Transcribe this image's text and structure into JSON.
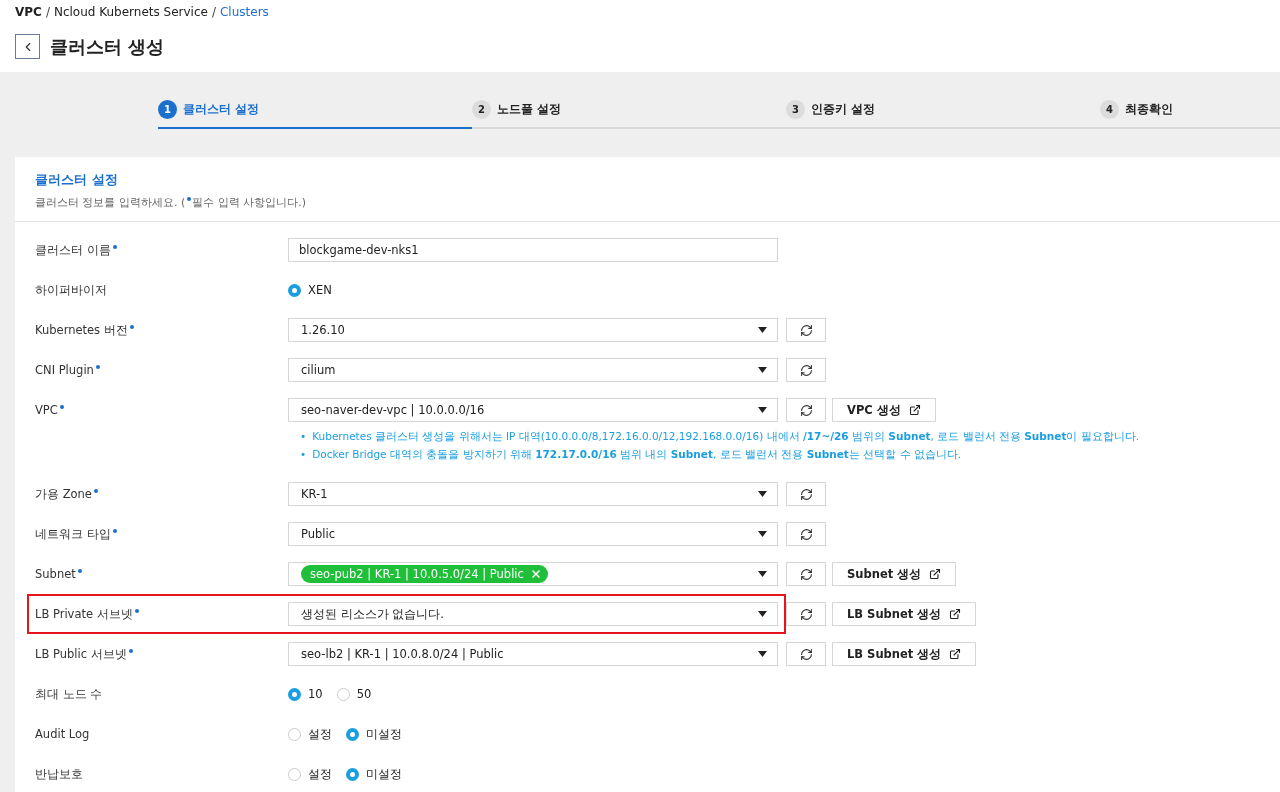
{
  "breadcrumb": {
    "separator": "/",
    "items": [
      {
        "label": "VPC",
        "kind": "root"
      },
      {
        "label": "Ncloud Kubernets Service",
        "kind": "link"
      },
      {
        "label": "Clusters",
        "kind": "current"
      }
    ]
  },
  "page_title": "클러스터 생성",
  "steps": [
    {
      "number": "1",
      "label": "클러스터 설정",
      "selected": true
    },
    {
      "number": "2",
      "label": "노드풀 설정",
      "selected": false
    },
    {
      "number": "3",
      "label": "인증키 설정",
      "selected": false
    },
    {
      "number": "4",
      "label": "최종확인",
      "selected": false
    }
  ],
  "section": {
    "title": "클러스터 설정",
    "description_before": "클러스터 정보를 입력하세요. (",
    "description_after": "필수 입력 사항입니다.)"
  },
  "fields": [
    {
      "kind": "text",
      "label": "클러스터 이름",
      "required": true,
      "value": "blockgame-dev-nks1",
      "highlighted": false
    },
    {
      "kind": "radio",
      "label": "하이퍼바이저",
      "required": false,
      "options": [
        {
          "label": "XEN",
          "selected": true
        }
      ],
      "highlighted": false
    },
    {
      "kind": "select",
      "label": "Kubernetes 버전",
      "required": true,
      "value": "1.26.10",
      "highlighted": false
    },
    {
      "kind": "select",
      "label": "CNI Plugin",
      "required": true,
      "value": "cilium",
      "highlighted": false
    },
    {
      "kind": "select",
      "label": "VPC",
      "required": true,
      "value": "seo-naver-dev-vpc | 10.0.0.0/16",
      "create_button": "VPC 생성",
      "highlighted": false,
      "notes": [
        {
          "marker": "•",
          "text": "Kubernetes 클러스터 생성을 위해서는 IP 대역(10.0.0.0/8,172.16.0.0/12,192.168.0.0/16) 내에서 **/17~/26** 범위의 **Subnet**, 로드 밸런서 전용 **Subnet**이 필요합니다."
        },
        {
          "marker": "•",
          "text": "Docker Bridge 대역의 충돌을 방지하기 위해 **172.17.0.0/16** 범위 내의 **Subnet**, 로드 밸런서 전용 **Subnet**는 선택할 수 없습니다."
        }
      ]
    },
    {
      "kind": "select",
      "label": "가용 Zone",
      "required": true,
      "value": "KR-1",
      "highlighted": false
    },
    {
      "kind": "select",
      "label": "네트워크 타입",
      "required": true,
      "value": "Public",
      "highlighted": false
    },
    {
      "kind": "select",
      "label": "Subnet",
      "required": true,
      "chips": [
        "seo-pub2 | KR-1 | 10.0.5.0/24 | Public"
      ],
      "create_button": "Subnet 생성",
      "highlighted": false
    },
    {
      "kind": "select",
      "label": "LB Private 서브넷",
      "required": true,
      "value": "생성된 리소스가 없습니다.",
      "create_button": "LB Subnet 생성",
      "highlighted": true
    },
    {
      "kind": "select",
      "label": "LB Public 서브넷",
      "required": true,
      "value": "seo-lb2 | KR-1 | 10.0.8.0/24 | Public",
      "create_button": "LB Subnet 생성",
      "highlighted": false
    },
    {
      "kind": "radio",
      "label": "최대 노드 수",
      "required": false,
      "options": [
        {
          "label": "10",
          "selected": true
        },
        {
          "label": "50",
          "selected": false
        }
      ],
      "highlighted": false
    },
    {
      "kind": "radio",
      "label": "Audit Log",
      "required": false,
      "options": [
        {
          "label": "설정",
          "selected": false
        },
        {
          "label": "미설정",
          "selected": true
        }
      ],
      "highlighted": false
    },
    {
      "kind": "radio",
      "label": "반납보호",
      "required": false,
      "options": [
        {
          "label": "설정",
          "selected": false
        },
        {
          "label": "미설정",
          "selected": true
        }
      ],
      "highlighted": false
    }
  ]
}
